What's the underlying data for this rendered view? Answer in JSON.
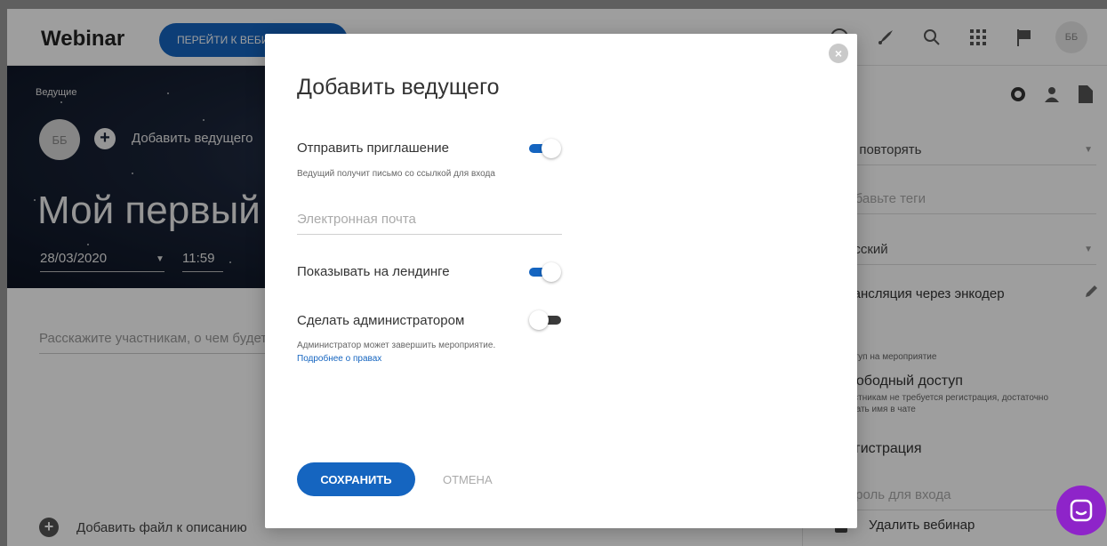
{
  "app": {
    "logo": "Webinar",
    "goto_button": "ПЕРЕЙТИ К ВЕБИНАРУ",
    "avatar_initials": "ББ"
  },
  "hero": {
    "hosts_label": "Ведущие",
    "host_initials": "ББ",
    "add_host": "Добавить ведущего",
    "title": "Мой первый вебинар",
    "date": "28/03/2020",
    "time": "11:59"
  },
  "main": {
    "description_placeholder": "Расскажите участникам, о чем будет вебинар",
    "add_file": "Добавить файл к описанию"
  },
  "right": {
    "repeat_value": "Не повторять",
    "tags_placeholder": "Добавьте теги",
    "language_value": "Русский",
    "encoder_label": "Трансляция через энкодер",
    "access_label": "Доступ на мероприятие",
    "free_access_title": "Свободный доступ",
    "free_access_hint_line1": "Участникам не требуется регистрация, достаточно",
    "free_access_hint_line2": "указать имя в чате",
    "registration_title": "Регистрация",
    "password_placeholder": "Пароль для входа",
    "delete_webinar": "Удалить вебинар"
  },
  "modal": {
    "title": "Добавить ведущего",
    "send_invite_label": "Отправить приглашение",
    "send_invite_on": true,
    "send_invite_hint": "Ведущий получит письмо со ссылкой для входа",
    "email_placeholder": "Электронная почта",
    "show_on_landing_label": "Показывать на лендинге",
    "show_on_landing_on": true,
    "make_admin_label": "Сделать администратором",
    "make_admin_on": false,
    "make_admin_hint": "Администратор может завершить мероприятие.",
    "rights_link": "Подробнее о правах",
    "save_button": "СОХРАНИТЬ",
    "cancel_button": "ОТМЕНА"
  },
  "colors": {
    "accent": "#1565c0",
    "chat": "#8e24c9"
  }
}
